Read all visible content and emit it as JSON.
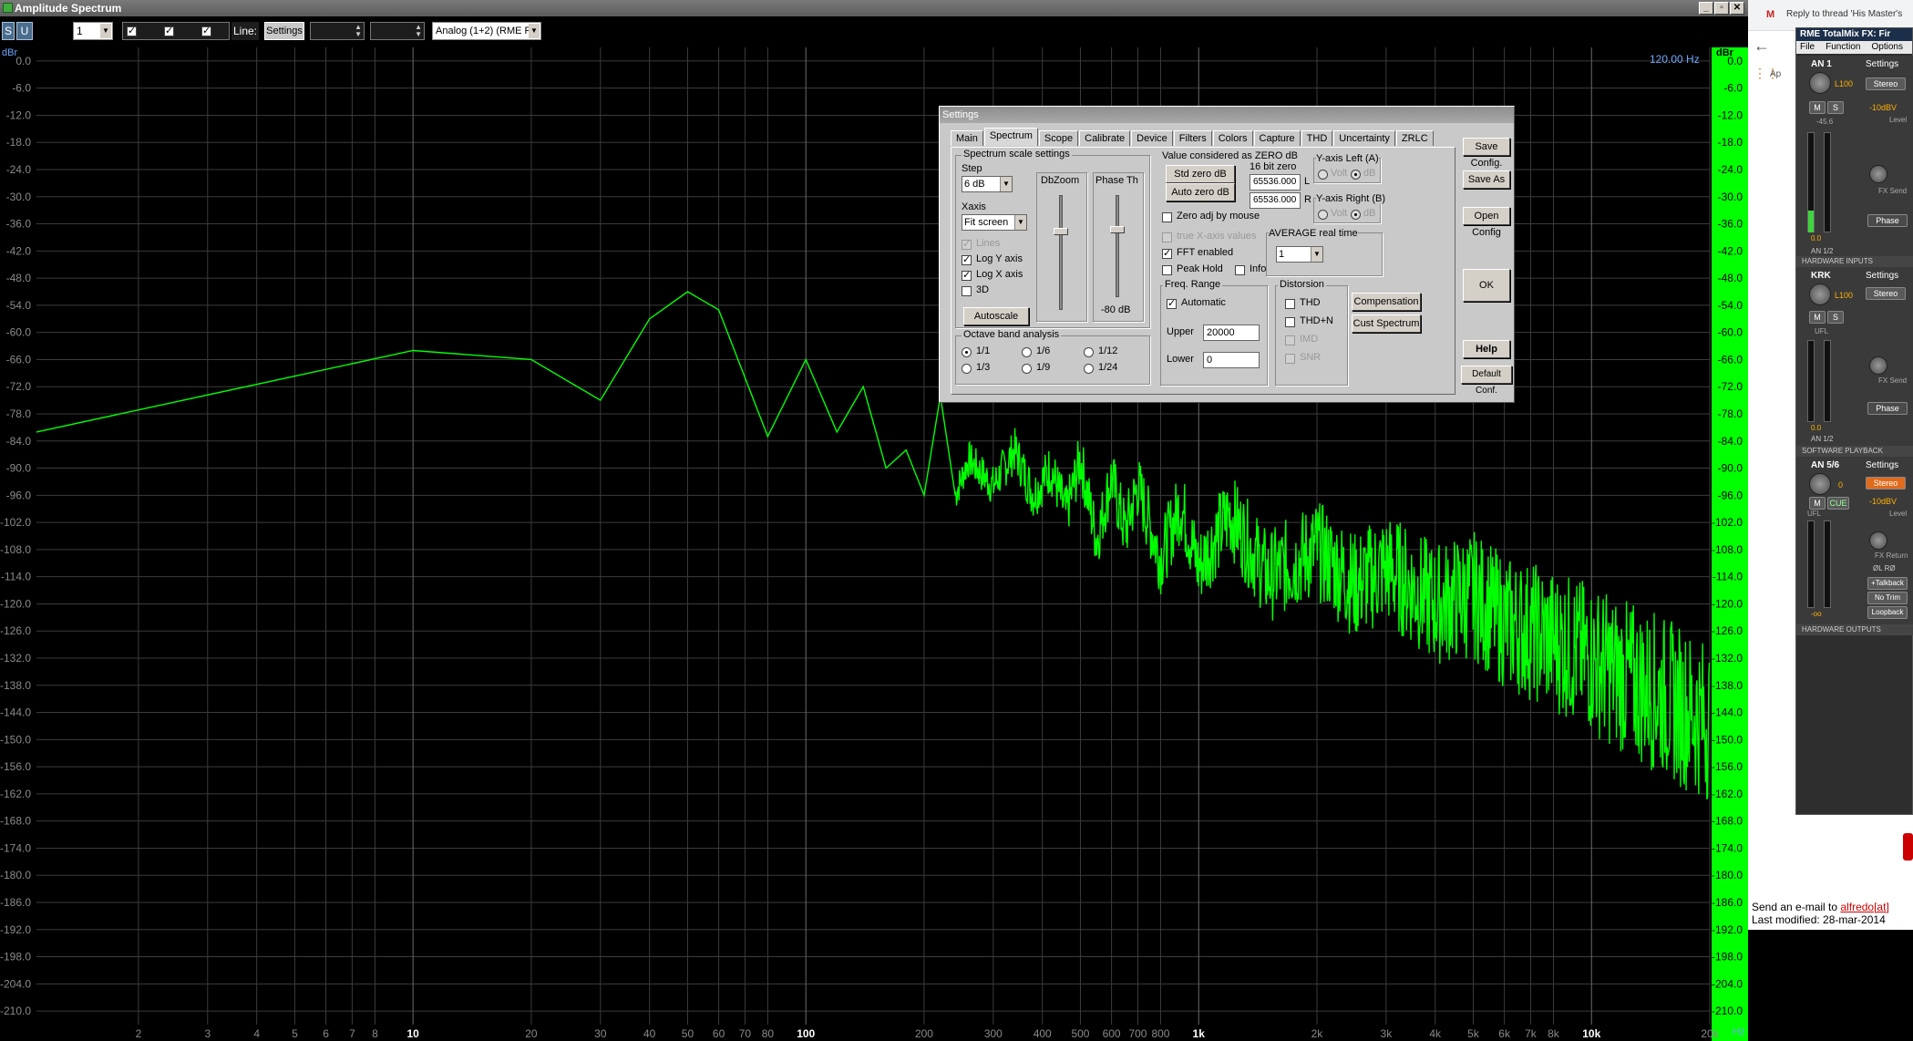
{
  "window": {
    "title": "Amplitude Spectrum",
    "controls": [
      "_",
      "▫",
      "✕"
    ]
  },
  "toolbar": {
    "s_label": "S",
    "u_label": "U",
    "channel_value": "1",
    "line_label": "Line:",
    "settings_label": "Settings",
    "source_value": "Analog (1+2) (RME F"
  },
  "plot": {
    "y_unit_left": "dBr",
    "y_unit_right": "dBr",
    "x_unit": "Hz",
    "cursor_readout": "120.00 Hz",
    "y_ticks": [
      "0.0",
      "-6.0",
      "-12.0",
      "-18.0",
      "-24.0",
      "-30.0",
      "-36.0",
      "-42.0",
      "-48.0",
      "-54.0",
      "-60.0",
      "-66.0",
      "-72.0",
      "-78.0",
      "-84.0",
      "-90.0",
      "-96.0",
      "-102.0",
      "-108.0",
      "-114.0",
      "-120.0",
      "-126.0",
      "-132.0",
      "-138.0",
      "-144.0",
      "-150.0",
      "-156.0",
      "-162.0",
      "-168.0",
      "-174.0",
      "-180.0",
      "-186.0",
      "-192.0",
      "-198.0",
      "-204.0",
      "-210.0"
    ],
    "x_ticks": [
      {
        "f": 2,
        "label": "2"
      },
      {
        "f": 3,
        "label": "3"
      },
      {
        "f": 4,
        "label": "4"
      },
      {
        "f": 5,
        "label": "5"
      },
      {
        "f": 6,
        "label": "6"
      },
      {
        "f": 7,
        "label": "7"
      },
      {
        "f": 8,
        "label": "8"
      },
      {
        "f": 10,
        "label": "10",
        "major": true
      },
      {
        "f": 20,
        "label": "20"
      },
      {
        "f": 30,
        "label": "30"
      },
      {
        "f": 40,
        "label": "40"
      },
      {
        "f": 50,
        "label": "50"
      },
      {
        "f": 60,
        "label": "60"
      },
      {
        "f": 70,
        "label": "70"
      },
      {
        "f": 80,
        "label": "80"
      },
      {
        "f": 100,
        "label": "100",
        "major": true
      },
      {
        "f": 200,
        "label": "200"
      },
      {
        "f": 300,
        "label": "300"
      },
      {
        "f": 400,
        "label": "400"
      },
      {
        "f": 500,
        "label": "500"
      },
      {
        "f": 600,
        "label": "600"
      },
      {
        "f": 700,
        "label": "700"
      },
      {
        "f": 800,
        "label": "800"
      },
      {
        "f": 1000,
        "label": "1k",
        "major": true
      },
      {
        "f": 2000,
        "label": "2k"
      },
      {
        "f": 3000,
        "label": "3k"
      },
      {
        "f": 4000,
        "label": "4k"
      },
      {
        "f": 5000,
        "label": "5k"
      },
      {
        "f": 6000,
        "label": "6k"
      },
      {
        "f": 7000,
        "label": "7k"
      },
      {
        "f": 8000,
        "label": "8k"
      },
      {
        "f": 10000,
        "label": "10k",
        "major": true
      },
      {
        "f": 20000,
        "label": "20k"
      }
    ],
    "colors": {
      "trace": "#00ff00",
      "grid": "#3c3c3c",
      "right_scale": "#00ff00",
      "label_blue": "#6ea8ff"
    }
  },
  "chart_data": {
    "type": "line",
    "xlabel": "Hz",
    "ylabel": "dBr",
    "xscale": "log",
    "xlim": [
      1.1,
      20000
    ],
    "ylim": [
      -213,
      3
    ],
    "series": [
      {
        "points": [
          [
            1.1,
            -82
          ],
          [
            10,
            -64
          ],
          [
            20,
            -66
          ],
          [
            30,
            -75
          ],
          [
            40,
            -57
          ],
          [
            50,
            -51
          ],
          [
            60,
            -55
          ],
          [
            80,
            -83
          ],
          [
            100,
            -66
          ],
          [
            120,
            -82
          ],
          [
            140,
            -72
          ],
          [
            160,
            -90
          ],
          [
            180,
            -86
          ],
          [
            200,
            -96
          ],
          [
            220,
            -74
          ],
          [
            240,
            -96
          ],
          [
            260,
            -88
          ],
          [
            300,
            -94
          ],
          [
            340,
            -86
          ],
          [
            380,
            -96
          ],
          [
            420,
            -90
          ],
          [
            460,
            -100
          ],
          [
            500,
            -88
          ],
          [
            550,
            -106
          ],
          [
            600,
            -92
          ],
          [
            650,
            -104
          ],
          [
            700,
            -94
          ],
          [
            800,
            -110
          ],
          [
            900,
            -98
          ],
          [
            1000,
            -112
          ],
          [
            1200,
            -100
          ],
          [
            1500,
            -114
          ],
          [
            2000,
            -108
          ],
          [
            2500,
            -116
          ],
          [
            3000,
            -112
          ],
          [
            4000,
            -120
          ],
          [
            5000,
            -118
          ],
          [
            6000,
            -124
          ],
          [
            7000,
            -126
          ],
          [
            8000,
            -128
          ],
          [
            10000,
            -132
          ],
          [
            12000,
            -136
          ],
          [
            15000,
            -140
          ],
          [
            18000,
            -144
          ],
          [
            20000,
            -146
          ]
        ]
      }
    ],
    "noise_envelope": {
      "upper": [
        [
          500,
          -88
        ],
        [
          1000,
          -96
        ],
        [
          2000,
          -102
        ],
        [
          5000,
          -110
        ],
        [
          10000,
          -118
        ],
        [
          20000,
          -124
        ]
      ],
      "lower": [
        [
          500,
          -112
        ],
        [
          1000,
          -118
        ],
        [
          2000,
          -124
        ],
        [
          5000,
          -132
        ],
        [
          10000,
          -140
        ],
        [
          20000,
          -150
        ]
      ]
    }
  },
  "dialog": {
    "title": "Settings",
    "tabs": [
      "Main",
      "Spectrum",
      "Scope",
      "Calibrate",
      "Device",
      "Filters",
      "Colors",
      "Capture",
      "THD",
      "Uncertainty",
      "ZRLC"
    ],
    "active_tab": "Spectrum",
    "scale_group": "Spectrum scale settings",
    "step_label": "Step",
    "step_value": "6 dB",
    "xaxis_label": "Xaxis",
    "xaxis_value": "Fit screen",
    "lines_label": "Lines",
    "logy_label": "Log Y axis",
    "logx_label": "Log X axis",
    "threed_label": "3D",
    "autoscale_label": "Autoscale",
    "dbzoom_label": "DbZoom",
    "phase_label": "Phase Th",
    "phase_value": "-80 dB",
    "octave_group": "Octave band analysis",
    "octave_opts": [
      "1/1",
      "1/6",
      "1/12",
      "1/3",
      "1/9",
      "1/24"
    ],
    "zero_group": "Value considered as ZERO dB",
    "std_zero": "Std zero dB",
    "auto_zero": "Auto zero dB",
    "bit16_label": "16 bit zero",
    "zero_l": "65536.000",
    "zero_r": "65536.000",
    "l_label": "L",
    "r_label": "R",
    "zero_adj": "Zero adj by mouse",
    "true_x": "true X-axis values",
    "fft_enabled": "FFT enabled",
    "peak_hold": "Peak Hold",
    "info": "Info",
    "yleft_label": "Y-axis Left (A)",
    "yright_label": "Y-axis Right (B)",
    "volt_label": "Volt",
    "db_label": "dB",
    "avg_label": "AVERAGE real time",
    "avg_value": "1",
    "freq_group": "Freq. Range",
    "automatic": "Automatic",
    "upper_label": "Upper",
    "upper_value": "20000",
    "lower_label": "Lower",
    "lower_value": "0",
    "dist_group": "Distorsion",
    "thd": "THD",
    "thdn": "THD+N",
    "imd": "IMD",
    "snr": "SNR",
    "compensation": "Compensation",
    "cust_spectrum": "Cust Spectrum",
    "save_config": "Save Config.",
    "save_as": "Save As",
    "open_config": "Open Config",
    "ok": "OK",
    "help": "Help",
    "default_conf": "Default Conf."
  },
  "browser": {
    "tab_title": "Reply to thread 'His Master's",
    "apps_label": "Ap",
    "footer_text": "Send an e-mail to",
    "footer_link": "alfredo[at]",
    "modified": "Last modified: 28-mar-2014"
  },
  "totalmix": {
    "title": "RME TotalMix FX: Fir",
    "menu": [
      "File",
      "Function",
      "Options"
    ],
    "ch1": {
      "name": "AN 1",
      "settings": "Settings",
      "stereo": "Stereo",
      "gain": "L100",
      "level": "-10dBV",
      "level_label": "Level",
      "fx": "FX Send",
      "phase": "Phase",
      "fader": "0.0",
      "meter": "-45.6",
      "route": "AN 1/2"
    },
    "sec_inputs": "HARDWARE INPUTS",
    "ch2": {
      "name": "KRK",
      "settings": "Settings",
      "stereo": "Stereo",
      "gain": "L100",
      "ufl": "UFL",
      "fx": "FX Send",
      "phase": "Phase",
      "fader": "0.0",
      "route": "AN 1/2"
    },
    "sec_playback": "SOFTWARE PLAYBACK",
    "ch3": {
      "name": "AN 5/6",
      "settings": "Settings",
      "stereo": "Stereo",
      "gain": "0",
      "cue": "CUE",
      "level": "-10dBV",
      "level_label": "Level",
      "ufl": "UFL",
      "fx": "FX Return",
      "phase": "ØL RØ",
      "talkback": "+Talkback",
      "notrim": "No Trim",
      "loopback": "Loopback",
      "fader": "-oo"
    },
    "sec_outputs": "HARDWARE OUTPUTS",
    "m_label": "M",
    "s_label": "S"
  }
}
